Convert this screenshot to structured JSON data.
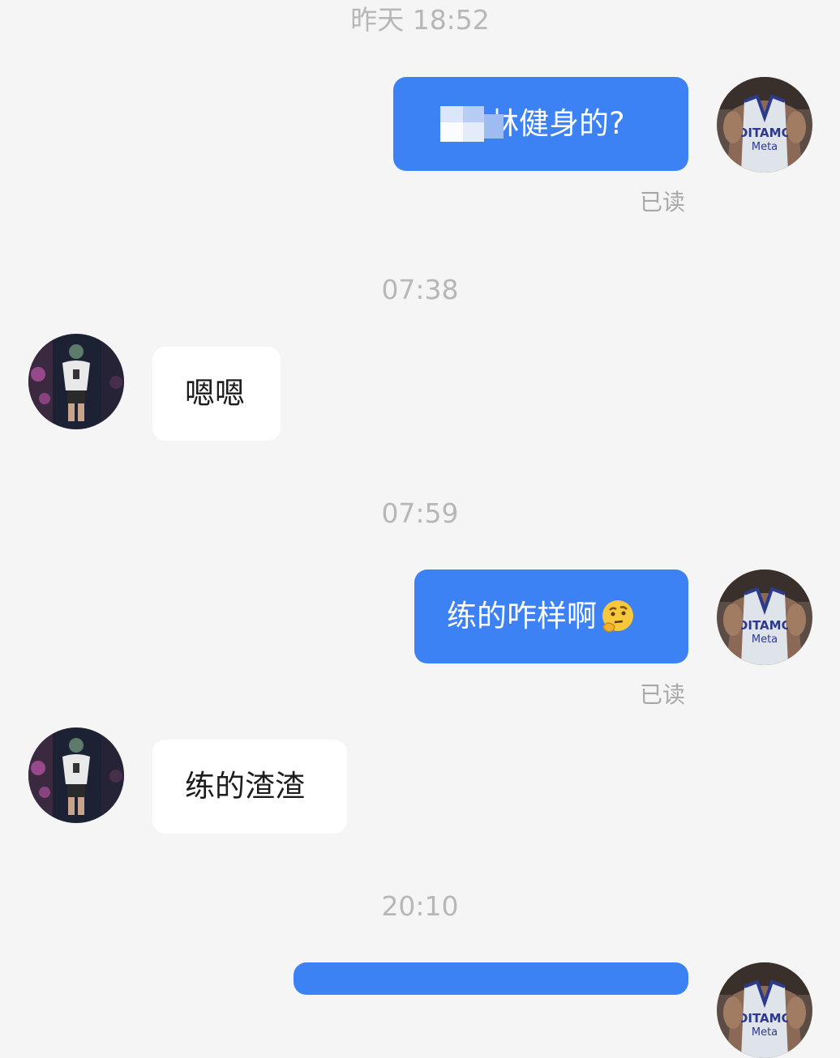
{
  "colors": {
    "background": "#f5f5f5",
    "outgoing_bubble": "#3d82f5",
    "incoming_bubble": "#ffffff",
    "timestamp": "#b7b7b7"
  },
  "timestamps": [
    "昨天 18:52",
    "07:38",
    "07:59",
    "20:10"
  ],
  "messages": [
    {
      "direction": "outgoing",
      "text": "林健身的?",
      "partially_obscured": true,
      "read_status": "已读",
      "avatar": "self-avatar"
    },
    {
      "direction": "incoming",
      "text": "嗯嗯",
      "avatar": "contact-avatar"
    },
    {
      "direction": "outgoing",
      "text": "练的咋样啊",
      "emoji": "thinking-face-emoji",
      "read_status": "已读",
      "avatar": "self-avatar"
    },
    {
      "direction": "incoming",
      "text": "练的渣渣",
      "avatar": "contact-avatar"
    }
  ]
}
